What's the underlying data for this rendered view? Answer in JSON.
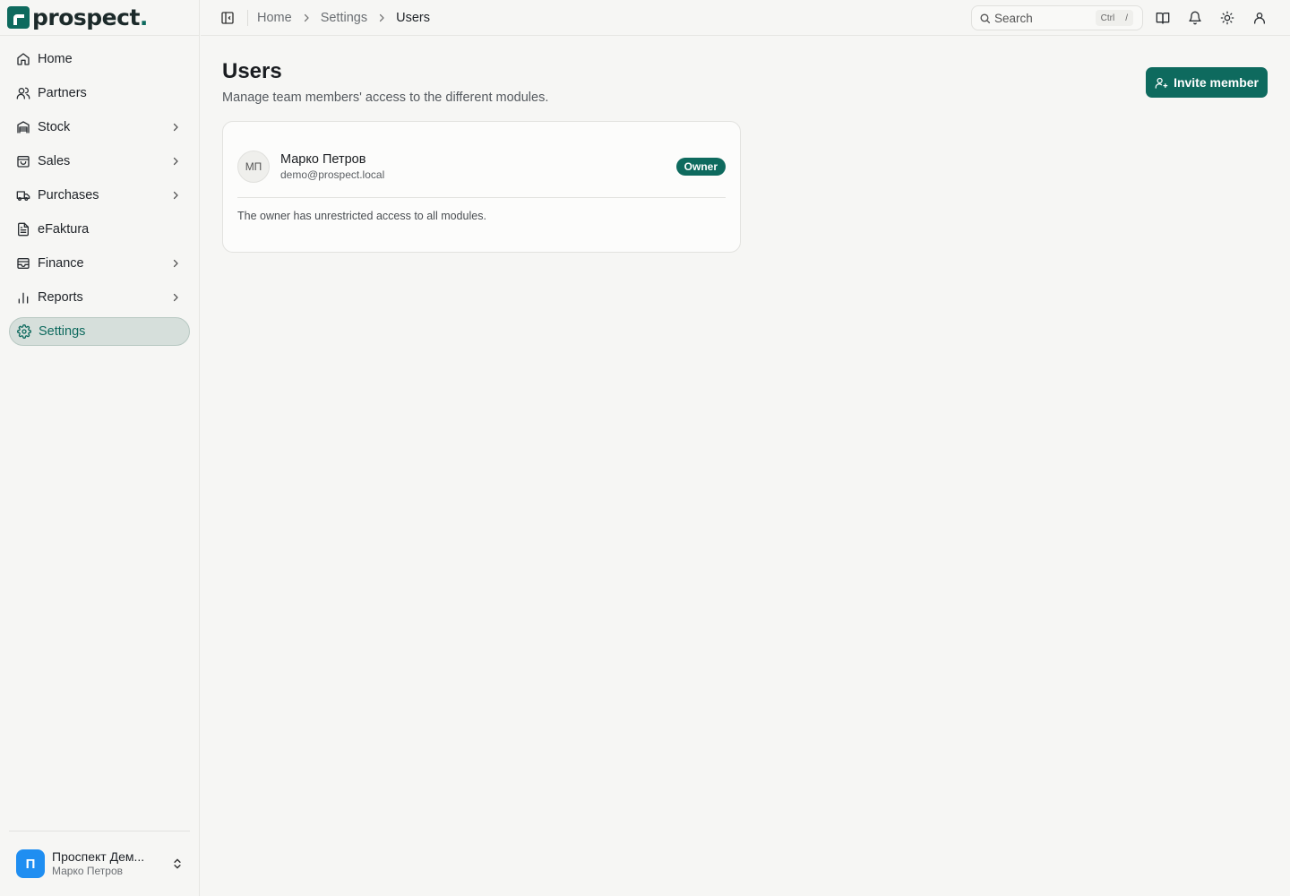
{
  "brand": {
    "name": "prospect",
    "dot": ".",
    "accent": "#0e6a5e"
  },
  "sidebar": {
    "items": [
      {
        "label": "Home",
        "icon": "home-icon",
        "has_submenu": false
      },
      {
        "label": "Partners",
        "icon": "users-icon",
        "has_submenu": false
      },
      {
        "label": "Stock",
        "icon": "warehouse-icon",
        "has_submenu": true
      },
      {
        "label": "Sales",
        "icon": "shopping-bag-icon",
        "has_submenu": true
      },
      {
        "label": "Purchases",
        "icon": "truck-icon",
        "has_submenu": true
      },
      {
        "label": "eFaktura",
        "icon": "document-icon",
        "has_submenu": false
      },
      {
        "label": "Finance",
        "icon": "wallet-icon",
        "has_submenu": true
      },
      {
        "label": "Reports",
        "icon": "bar-chart-icon",
        "has_submenu": true
      },
      {
        "label": "Settings",
        "icon": "gear-icon",
        "has_submenu": false,
        "active": true
      }
    ],
    "account": {
      "avatar_letter": "П",
      "org_name": "Проспект Дем...",
      "user_name": "Марко Петров",
      "avatar_color": "#1f8ef1"
    }
  },
  "topbar": {
    "breadcrumb": [
      "Home",
      "Settings",
      "Users"
    ],
    "search": {
      "placeholder": "Search",
      "shortcut_mod": "Ctrl",
      "shortcut_key": "/"
    }
  },
  "main": {
    "title": "Users",
    "subtitle": "Manage team members' access to the different modules.",
    "invite_label": "Invite member",
    "members": [
      {
        "initials": "МП",
        "name": "Марко Петров",
        "email": "demo@prospect.local",
        "role": "Owner",
        "note": "The owner has unrestricted access to all modules."
      }
    ]
  }
}
